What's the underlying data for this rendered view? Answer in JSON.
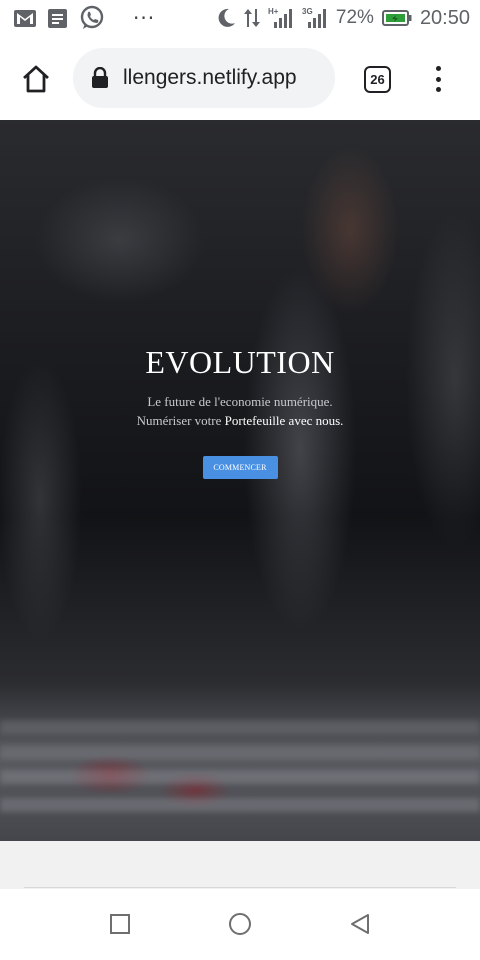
{
  "status_bar": {
    "battery": "72%",
    "time": "20:50",
    "overflow": "···",
    "network_label": "3G",
    "icons": [
      "gmail-icon",
      "document-icon",
      "whatsapp-icon",
      "moon-icon",
      "data-arrows-icon",
      "signal-icon",
      "battery-icon"
    ]
  },
  "browser": {
    "url": "llengers.netlify.app",
    "tab_count": "26",
    "icons": [
      "home-icon",
      "lock-icon",
      "tabs-icon",
      "menu-icon"
    ]
  },
  "hero": {
    "title": "EVOLUTION",
    "line1": "Le future de l'economie numérique.",
    "line2_prefix": "Numériser votre ",
    "line2_highlight": "Portefeuille avec nous.",
    "cta_label": "COMMENCER"
  },
  "nav": {
    "icons": [
      "recents-icon",
      "home-circle-icon",
      "back-icon"
    ]
  },
  "colors": {
    "accent": "#4a90e2",
    "status_icon": "#5f6368",
    "url_pill": "#f1f3f4"
  }
}
